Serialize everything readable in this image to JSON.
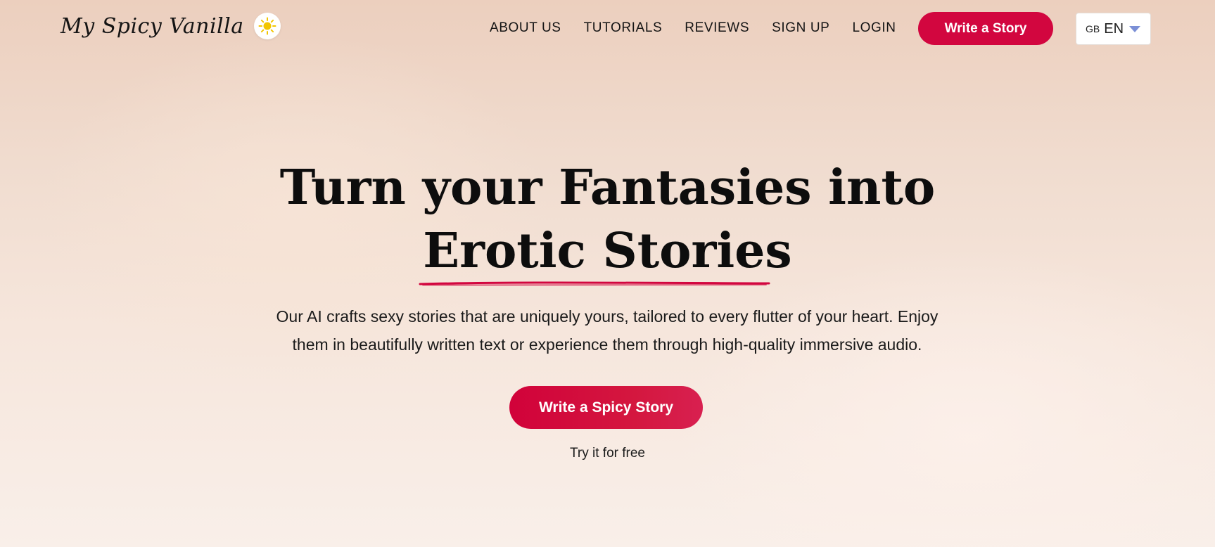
{
  "header": {
    "logo_text": "My Spicy Vanilla",
    "theme_toggle_icon": "sun-icon",
    "nav": [
      {
        "label": "ABOUT US"
      },
      {
        "label": "TUTORIALS"
      },
      {
        "label": "REVIEWS"
      },
      {
        "label": "SIGN UP"
      },
      {
        "label": "LOGIN"
      }
    ],
    "cta_label": "Write a Story",
    "language": {
      "flag": "GB",
      "code": "EN"
    }
  },
  "hero": {
    "title_line1": "Turn your Fantasies into",
    "title_line2": "Erotic Stories",
    "subtitle_line1": "Our AI crafts sexy stories that are uniquely yours, tailored to every flutter of your heart. Enjoy",
    "subtitle_line2": "them in beautifully written text or experience them through high-quality immersive audio.",
    "cta_label": "Write a Spicy Story",
    "cta_note": "Try it for free"
  },
  "colors": {
    "accent": "#d2063f",
    "sun": "#f2c500",
    "chevron": "#7b8fd6"
  }
}
